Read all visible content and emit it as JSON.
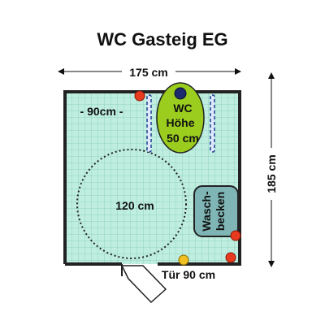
{
  "title": "WC Gasteig EG",
  "dimensions": {
    "width": "175 cm",
    "height": "185 cm"
  },
  "labels": {
    "free_width": "- 90cm -",
    "turning_circle": "120 cm",
    "door": "Tür 90 cm",
    "wc_line1": "WC",
    "wc_line2": "Höhe",
    "wc_line3": "50 cm",
    "sink_line1": "Wasch-",
    "sink_line2": "becken"
  },
  "colors": {
    "tile": "#bfeee0",
    "grid": "#8fd0c0",
    "wall": "#222222",
    "wc": "#9acd1e",
    "sink": "#7fb5b5",
    "rail": "#1c3c8c",
    "dot_red": "#e83a1e",
    "dot_navy": "#1c2a6e",
    "dot_yellow": "#f0c020"
  },
  "icons": {
    "wc": "toilet-icon",
    "sink": "sink-icon",
    "rail": "grab-rail-icon",
    "door": "door-swing-icon"
  }
}
